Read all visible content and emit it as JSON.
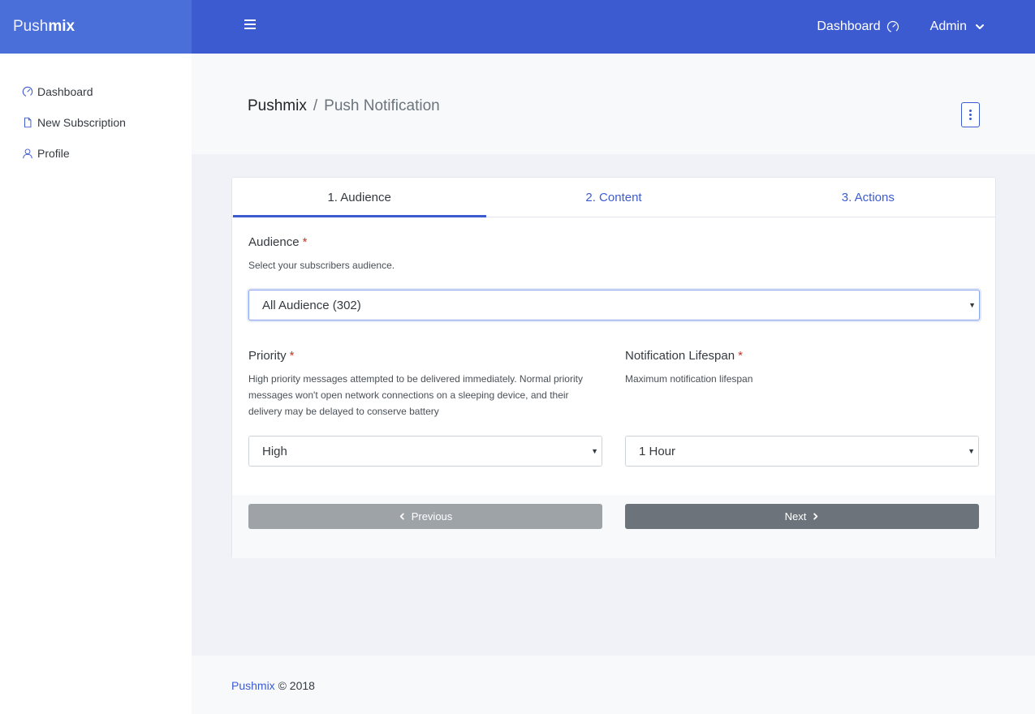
{
  "brand": {
    "part1": "Push",
    "part2": "mix"
  },
  "sidebar": {
    "items": [
      {
        "label": "Dashboard",
        "icon": "speedometer-icon"
      },
      {
        "label": "New Subscription",
        "icon": "document-icon"
      },
      {
        "label": "Profile",
        "icon": "user-icon"
      }
    ]
  },
  "header": {
    "dashboard_label": "Dashboard",
    "user_label": "Admin"
  },
  "breadcrumb": {
    "root": "Pushmix",
    "separator": "/",
    "current": "Push Notification"
  },
  "tabs": [
    {
      "label": "1. Audience",
      "active": true
    },
    {
      "label": "2. Content",
      "active": false
    },
    {
      "label": "3. Actions",
      "active": false
    }
  ],
  "form": {
    "audience": {
      "label": "Audience",
      "required_mark": "*",
      "help": "Select your subscribers audience.",
      "value": "All Audience (302)"
    },
    "priority": {
      "label": "Priority",
      "required_mark": "*",
      "help": "High priority messages attempted to be delivered immediately. Normal priority messages won't open network connections on a sleeping device, and their delivery may be delayed to conserve battery",
      "value": "High"
    },
    "lifespan": {
      "label": "Notification Lifespan",
      "required_mark": "*",
      "help": "Maximum notification lifespan",
      "value": "1 Hour"
    }
  },
  "buttons": {
    "previous": "Previous",
    "next": "Next"
  },
  "footer": {
    "brand": "Pushmix",
    "copyright": " © 2018"
  },
  "colors": {
    "primary": "#3d5bd0",
    "brand_bg": "#4a6fd8",
    "required": "#c0392b",
    "btn_prev": "#9ea3a8",
    "btn_next": "#6c737b"
  }
}
